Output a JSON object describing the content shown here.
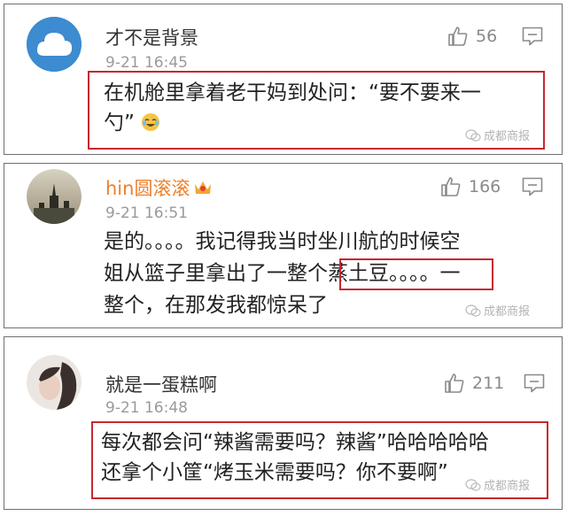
{
  "watermark": "成都商报",
  "comments": [
    {
      "username": "才不是背景",
      "time": "9-21 16:45",
      "likes": "56",
      "lines": [
        "在机舱里拿着老干妈到处问：“要不要来一",
        "勺”"
      ],
      "emoji": "laughing-crying"
    },
    {
      "username": "hin圆滚滚",
      "time": "9-21 16:51",
      "likes": "166",
      "vip": true,
      "lines": [
        "是的。。。。我记得我当时坐川航的时候空",
        "姐从篮子里拿出了一整个蒸土豆。。。。一",
        "整个，在那发我都惊呆了"
      ]
    },
    {
      "username": "就是一蛋糕啊",
      "time": "9-21 16:48",
      "likes": "211",
      "lines": [
        "每次都会问“辣酱需要吗？辣酱”哈哈哈哈哈",
        "还拿个小筐“烤玉米需要吗？你不要啊”"
      ]
    }
  ]
}
